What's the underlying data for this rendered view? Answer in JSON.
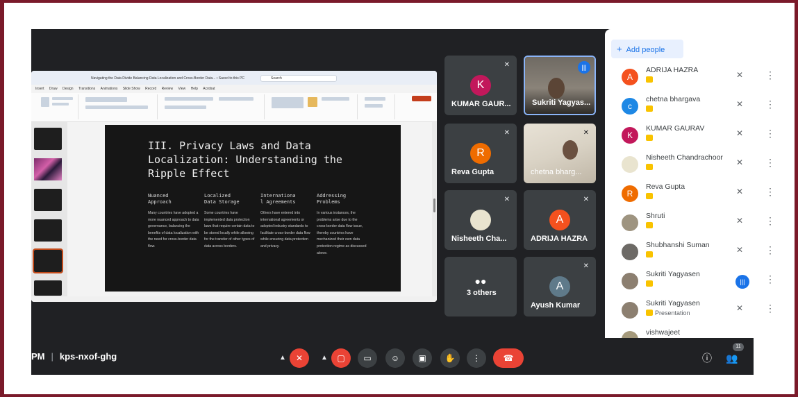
{
  "meeting": {
    "time_fragment": "PM",
    "code": "kps-nxof-ghg"
  },
  "presentation": {
    "window_title": "Navigating the Data Divide Balancing Data Localization and Cross-Border Data... • Saved to this PC",
    "search_placeholder": "Search",
    "ribbon_tabs": [
      "Insert",
      "Draw",
      "Design",
      "Transitions",
      "Animations",
      "Slide Show",
      "Record",
      "Review",
      "View",
      "Help",
      "Acrobat"
    ],
    "slide_title": "III. Privacy Laws and Data\nLocalization: Understanding the\nRipple Effect",
    "columns": [
      {
        "heading": "Nuanced\nApproach",
        "body": "Many countries have adopted a more nuanced approach to data governance, balancing the benefits of data localization with the need for cross-border data flow."
      },
      {
        "heading": "Localized\nData Storage",
        "body": "Some countries have implemented data protection laws that require certain data to be stored locally while allowing for the transfer of other types of data across borders."
      },
      {
        "heading": "Internationa\nl Agreements",
        "body": "Others have entered into international agreements or adopted industry standards to facilitate cross-border data flow while ensuring data protection and privacy."
      },
      {
        "heading": "Addressing\nProblems",
        "body": "In various instances, the problems arise due to the cross-border data flow issue, thereby countries have mechanized their own data protection regime as discussed above."
      }
    ]
  },
  "tiles": [
    {
      "name": "KUMAR GAUR...",
      "initial": "K",
      "color": "#c2185b"
    },
    {
      "name": "Sukriti Yagyas..."
    },
    {
      "name": "Reva Gupta",
      "initial": "R",
      "color": "#ef6c00"
    },
    {
      "name": "chetna bharg..."
    },
    {
      "name": "Nisheeth Cha..."
    },
    {
      "name": "ADRIJA HAZRA",
      "initial": "A",
      "color": "#f4511e"
    },
    {
      "name": "3 others"
    },
    {
      "name": "Ayush Kumar",
      "initial": "A",
      "color": "#5f7a8a"
    }
  ],
  "sidebar": {
    "add_people_label": "Add people",
    "participants": [
      {
        "name": "ADRIJA HAZRA",
        "initial": "A",
        "color": "#f4511e"
      },
      {
        "name": "chetna bhargava",
        "initial": "c",
        "color": "#1e88e5"
      },
      {
        "name": "KUMAR GAURAV",
        "initial": "K",
        "color": "#c2185b"
      },
      {
        "name": "Nisheeth Chandrachoor",
        "initial": "",
        "color": "#e9e4cf"
      },
      {
        "name": "Reva Gupta",
        "initial": "R",
        "color": "#ef6c00"
      },
      {
        "name": "Shruti",
        "initial": "",
        "color": "#9e9480"
      },
      {
        "name": "Shubhanshi Suman",
        "initial": "",
        "color": "#6d6a66"
      },
      {
        "name": "Sukriti Yagyasen",
        "initial": "",
        "color": "#8c7f70"
      },
      {
        "name": "Sukriti Yagyasen",
        "initial": "",
        "color": "#8c7f70",
        "sub": "Presentation"
      },
      {
        "name": "vishwajeet",
        "initial": "",
        "color": "#a59a7c"
      }
    ]
  },
  "participant_count": "11"
}
